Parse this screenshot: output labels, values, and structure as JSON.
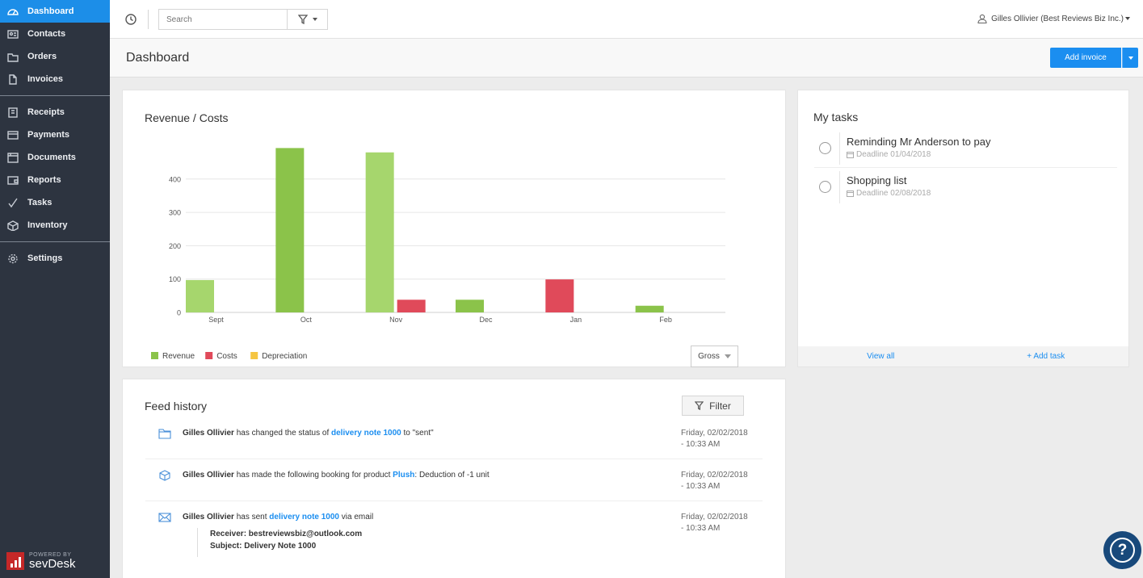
{
  "sidebar": {
    "items": [
      {
        "label": "Dashboard",
        "icon": "dashboard-icon"
      },
      {
        "label": "Contacts",
        "icon": "contacts-icon"
      },
      {
        "label": "Orders",
        "icon": "folder-icon"
      },
      {
        "label": "Invoices",
        "icon": "document-icon"
      },
      {
        "label": "Receipts",
        "icon": "receipt-icon"
      },
      {
        "label": "Payments",
        "icon": "card-icon"
      },
      {
        "label": "Documents",
        "icon": "archive-icon"
      },
      {
        "label": "Reports",
        "icon": "wallet-icon"
      },
      {
        "label": "Tasks",
        "icon": "check-icon"
      },
      {
        "label": "Inventory",
        "icon": "box-icon"
      },
      {
        "label": "Settings",
        "icon": "gear-icon"
      }
    ],
    "powered_by": "POWERED BY",
    "brand": "sevDesk"
  },
  "topbar": {
    "search_placeholder": "Search",
    "user": "Gilles Ollivier (Best Reviews Biz Inc.)"
  },
  "header": {
    "title": "Dashboard",
    "add_invoice": "Add invoice"
  },
  "revenue_card": {
    "title": "Revenue / Costs",
    "gross_select": "Gross"
  },
  "chart_data": {
    "type": "bar",
    "categories": [
      "Sept",
      "Oct",
      "Nov",
      "Dec",
      "Jan",
      "Feb"
    ],
    "series": [
      {
        "name": "Revenue",
        "color": "#8bc34a",
        "values": [
          97,
          493,
          480,
          38,
          0,
          20
        ]
      },
      {
        "name": "Costs",
        "color": "#e04a5a",
        "values": [
          0,
          0,
          38,
          0,
          99,
          0
        ]
      },
      {
        "name": "Depreciation",
        "color": "#f5c542",
        "values": [
          0,
          0,
          0,
          0,
          0,
          0
        ]
      }
    ],
    "yticks": [
      "0",
      "100",
      "200",
      "300",
      "400"
    ],
    "ylim": [
      0,
      500
    ],
    "grid": true,
    "legend": "bottom-left"
  },
  "tasks": {
    "title": "My tasks",
    "items": [
      {
        "name": "Reminding Mr Anderson to pay",
        "deadline": "Deadline 01/04/2018"
      },
      {
        "name": "Shopping list",
        "deadline": "Deadline 02/08/2018"
      }
    ],
    "view_all": "View all",
    "add_task": "+ Add task"
  },
  "feed": {
    "title": "Feed history",
    "filter": "Filter",
    "items": [
      {
        "icon": "folder-icon",
        "user": "Gilles Ollivier",
        "pre": " has changed the status of ",
        "link": "delivery note 1000",
        "post": " to \"sent\"",
        "date1": "Friday, 02/02/2018",
        "date2": "- 10:33 AM"
      },
      {
        "icon": "box-icon",
        "user": "Gilles Ollivier",
        "pre": " has made the following booking for product ",
        "link": "Plush",
        "post": ": Deduction of -1 unit",
        "date1": "Friday, 02/02/2018",
        "date2": "- 10:33 AM"
      },
      {
        "icon": "mail-icon",
        "user": "Gilles Ollivier",
        "pre": " has sent ",
        "link": "delivery note 1000",
        "post": " via email",
        "date1": "Friday, 02/02/2018",
        "date2": "- 10:33 AM",
        "receiver": "Receiver: bestreviewsbiz@outlook.com",
        "subject": "Subject: Delivery Note 1000"
      }
    ]
  },
  "help": "?"
}
